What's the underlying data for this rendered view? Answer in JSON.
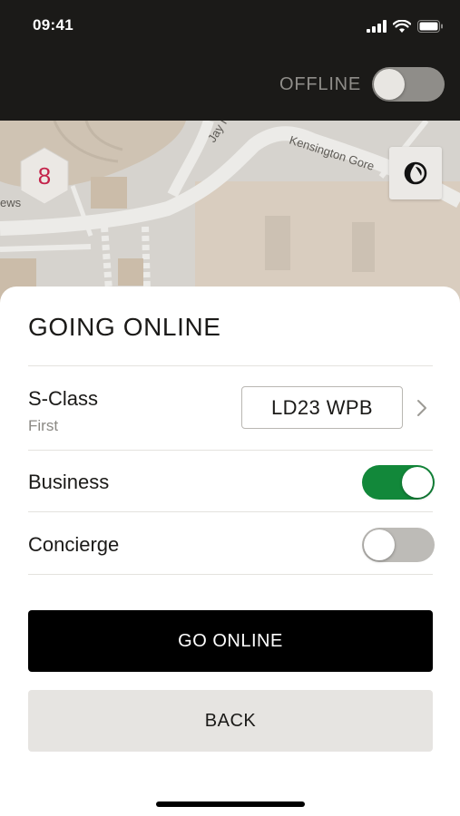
{
  "status_bar": {
    "time": "09:41"
  },
  "header": {
    "status_label": "OFFLINE",
    "online_toggle_on": false
  },
  "map": {
    "street_labels": [
      "Jay N",
      "Kensington Gore",
      "ews"
    ],
    "badge_count": "8",
    "badge_color": "#c4244b",
    "theme_icon": "contrast-icon"
  },
  "sheet": {
    "title": "GOING ONLINE",
    "vehicle": {
      "model": "S-Class",
      "class": "First",
      "plate": "LD23 WPB"
    },
    "services": [
      {
        "label": "Business",
        "enabled": true
      },
      {
        "label": "Concierge",
        "enabled": false
      }
    ],
    "primary_button": "GO ONLINE",
    "secondary_button": "BACK"
  },
  "colors": {
    "toggle_on": "#12883a",
    "toggle_off": "#bdbbb7",
    "badge": "#c4244b"
  }
}
